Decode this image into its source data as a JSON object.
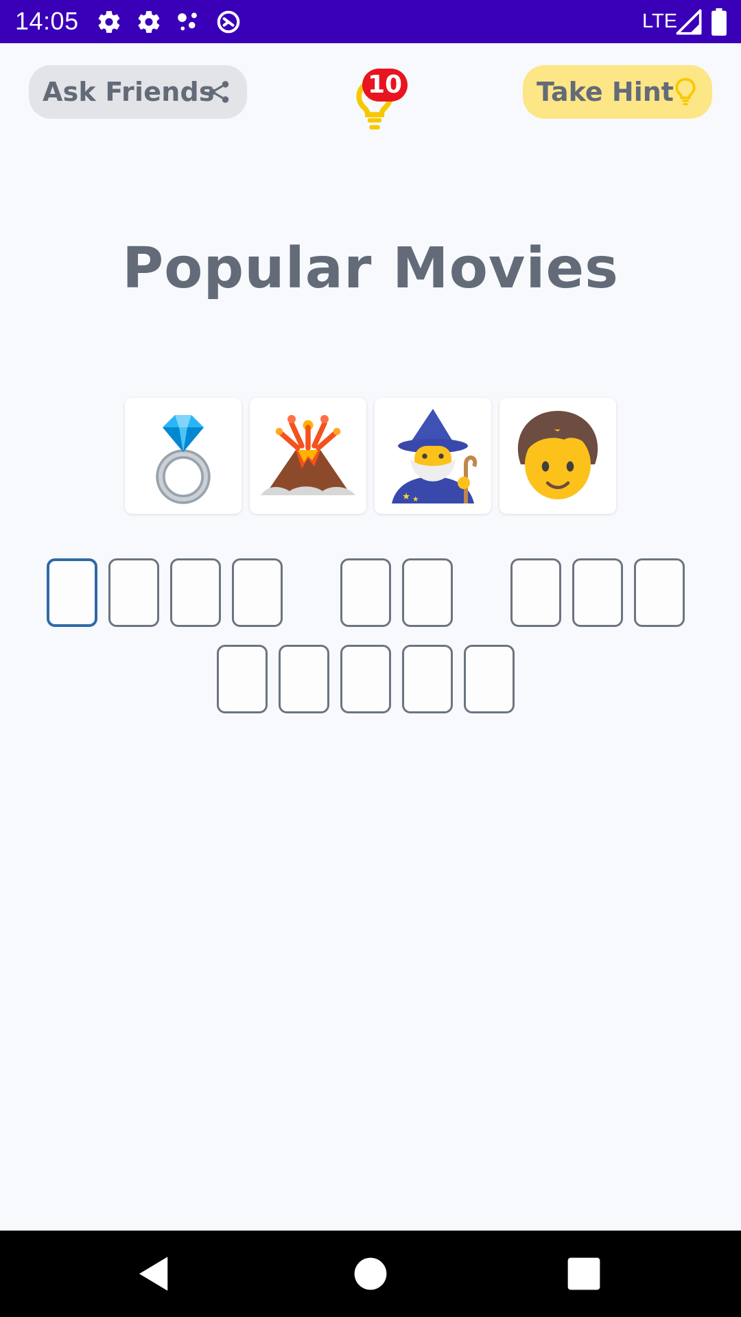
{
  "status_bar": {
    "time": "14:05",
    "network": "LTE",
    "icons": [
      "settings-icon",
      "settings-icon",
      "assistant-dots-icon",
      "sync-icon",
      "signal-icon",
      "battery-icon"
    ]
  },
  "top_bar": {
    "ask_friends_label": "Ask Friends",
    "take_hint_label": "Take Hint",
    "hint_count": "10"
  },
  "title": "Popular Movies",
  "emojis": [
    "ring-emoji",
    "volcano-emoji",
    "wizard-emoji",
    "child-emoji"
  ],
  "answer": {
    "words": [
      4,
      2,
      3,
      5
    ],
    "active_index": 0
  },
  "colors": {
    "status_bar": "#3a00b8",
    "ask_friends_bg": "#e3e4e8",
    "take_hint_bg": "#fce686",
    "badge": "#e8141f",
    "bulb": "#f7c800",
    "text": "#636b78"
  },
  "nav": [
    "back-button",
    "home-button",
    "recents-button"
  ]
}
